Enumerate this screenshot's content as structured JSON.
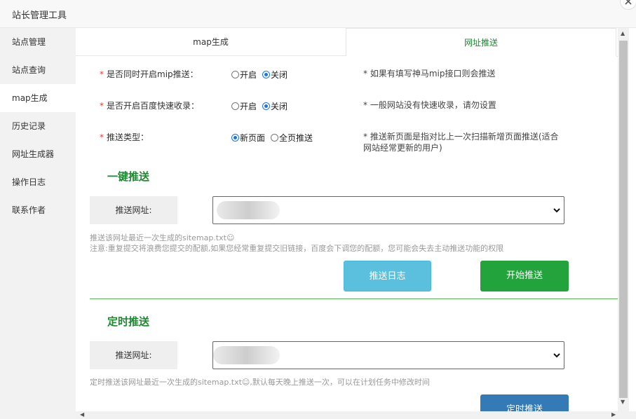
{
  "window": {
    "title": "站长管理工具"
  },
  "sidebar": {
    "items": [
      {
        "label": "站点管理"
      },
      {
        "label": "站点查询"
      },
      {
        "label": "map生成",
        "active": true
      },
      {
        "label": "历史记录"
      },
      {
        "label": "网址生成器"
      },
      {
        "label": "操作日志"
      },
      {
        "label": "联系作者"
      }
    ]
  },
  "tabs": [
    {
      "label": "map生成"
    },
    {
      "label": "网址推送",
      "active": true
    }
  ],
  "form": {
    "mip": {
      "label": "是否同时开启mip推送：",
      "options": [
        "开启",
        "关闭"
      ],
      "selected": "关闭",
      "hint": "* 如果有填写神马mip接口则会推送"
    },
    "fast": {
      "label": "是否开启百度快速收录：",
      "options": [
        "开启",
        "关闭"
      ],
      "selected": "关闭",
      "hint": "* 一般网站没有快速收录，请勿设置"
    },
    "type": {
      "label": "推送类型：",
      "options": [
        "新页面",
        "全页推送"
      ],
      "selected": "新页面",
      "hint": "* 推送新页面是指对比上一次扫描新增页面推送(适合网站经常更新的用户)"
    },
    "required_mark": "*"
  },
  "one_click": {
    "title": "一键推送",
    "url_label": "推送网址:",
    "note1": "推送该网址最近一次生成的sitemap.txt☺",
    "note2": "注意:重复提交将浪费您提交的配额,如果您经常重复提交旧链接，百度会下调您的配额，您可能会失去主动推送功能的权限",
    "log_button": "推送日志",
    "start_button": "开始推送"
  },
  "timed": {
    "title": "定时推送",
    "url_label": "推送网址:",
    "note": "定时推送该网址最近一次生成的sitemap.txt☺,默认每天晚上推送一次，可以在计划任务中修改时间",
    "button": "定时推送"
  },
  "colors": {
    "accent_green": "#1b8a2f",
    "start_green": "#22a33b",
    "log_blue": "#5bc0de",
    "timed_blue": "#337ab7"
  }
}
